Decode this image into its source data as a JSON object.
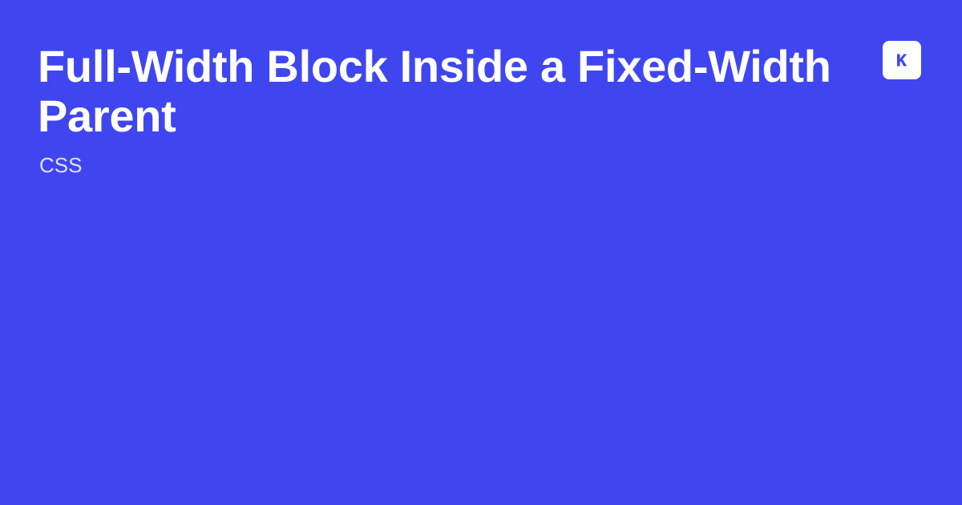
{
  "page": {
    "title": "Full-Width Block Inside a Fixed-Width Parent",
    "category": "CSS",
    "logo_icon": "k-logo-icon",
    "colors": {
      "background": "#3f46ef",
      "title": "#ffffff",
      "category": "#dfe2ff",
      "logo_bg": "#ffffff",
      "logo_fg": "#3f46ef"
    }
  }
}
